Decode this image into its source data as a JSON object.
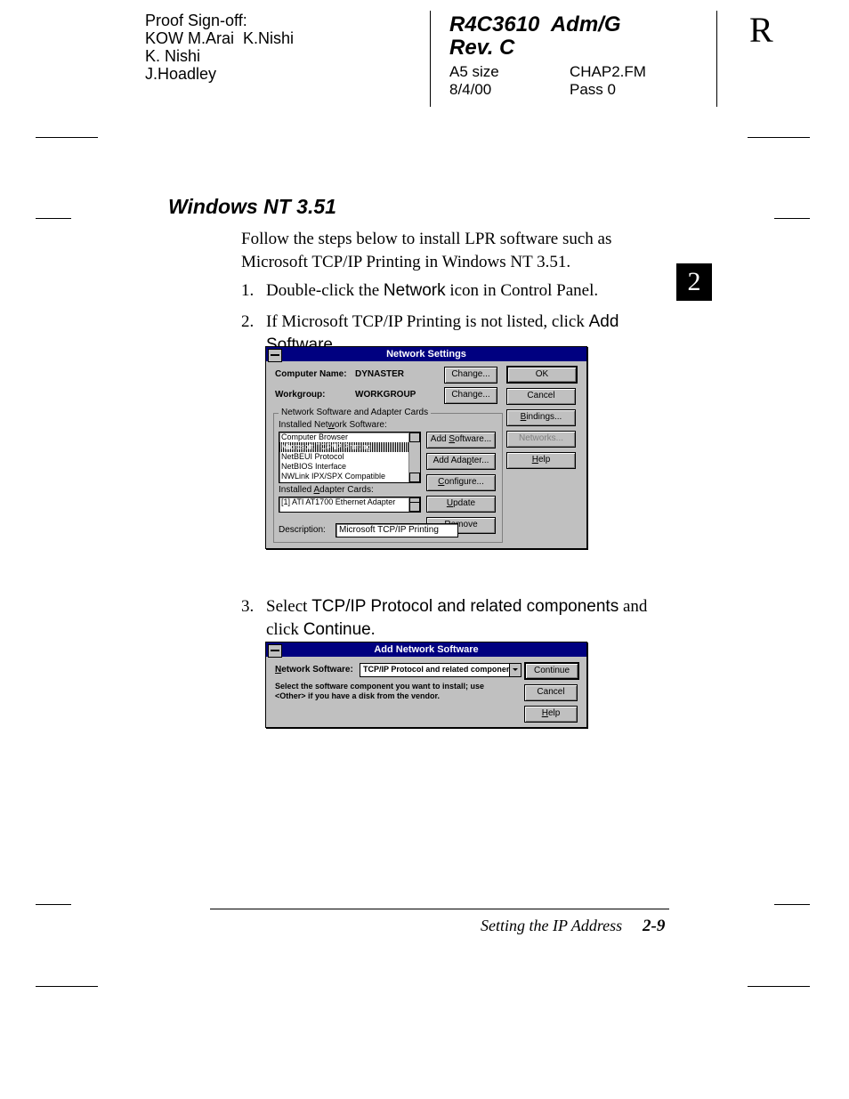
{
  "header": {
    "proof_label": "Proof Sign-off:",
    "proof_line1": "KOW M.Arai  K.Nishi",
    "proof_line2": "K. Nishi",
    "proof_line3": "J.Hoadley",
    "doc_id": "R4C3610  Adm/G",
    "rev": "Rev. C",
    "size": "A5 size",
    "file": "CHAP2.FM",
    "date": "8/4/00",
    "pass": "Pass 0",
    "side": "R"
  },
  "section_title": "Windows NT 3.51",
  "intro": "Follow the steps below to install LPR software such as Microsoft TCP/IP Printing in Windows NT 3.51.",
  "steps": {
    "s1_pre": "Double-click the ",
    "s1_ui": "Network",
    "s1_post": " icon in Control Panel.",
    "s2_pre": "If Microsoft TCP/IP Printing is not listed, click ",
    "s2_ui": "Add Software",
    "s2_post": ".",
    "s3_pre": "Select ",
    "s3_ui": "TCP/IP Protocol and related components",
    "s3_mid": " and click ",
    "s3_ui2": "Continue",
    "s3_post": "."
  },
  "tab_number": "2",
  "dlg1": {
    "title": "Network Settings",
    "computer_name_lbl": "Computer Name:",
    "computer_name_val": "DYNASTER",
    "workgroup_lbl": "Workgroup:",
    "workgroup_val": "WORKGROUP",
    "group_label": "Network Software and Adapter Cards",
    "installed_sw_lbl": "Installed Network Software:",
    "sw_items": [
      "Computer Browser",
      "Microsoft TCP/IP Printing",
      "NetBEUI Protocol",
      "NetBIOS Interface",
      "NWLink IPX/SPX Compatible Transport"
    ],
    "installed_ad_lbl": "Installed Adapter Cards:",
    "ad_items": [
      "[1] ATI AT1700 Ethernet Adapter"
    ],
    "desc_lbl": "Description:",
    "desc_val": "Microsoft TCP/IP Printing",
    "btn_change": "Change...",
    "btn_ok": "OK",
    "btn_cancel": "Cancel",
    "btn_bindings": "Bindings...",
    "btn_networks": "Networks...",
    "btn_help": "Help",
    "btn_addsw": "Add Software...",
    "btn_addad": "Add Adapter...",
    "btn_config": "Configure...",
    "btn_update": "Update",
    "btn_remove": "Remove"
  },
  "dlg2": {
    "title": "Add Network Software",
    "ns_lbl": "Network Software:",
    "ns_val": "TCP/IP Protocol and related components",
    "hint": "Select the software component you want to install; use <Other> if you have a disk from the vendor.",
    "btn_continue": "Continue",
    "btn_cancel": "Cancel",
    "btn_help": "Help"
  },
  "footer": {
    "section": "Setting the IP Address",
    "page": "2-9"
  }
}
